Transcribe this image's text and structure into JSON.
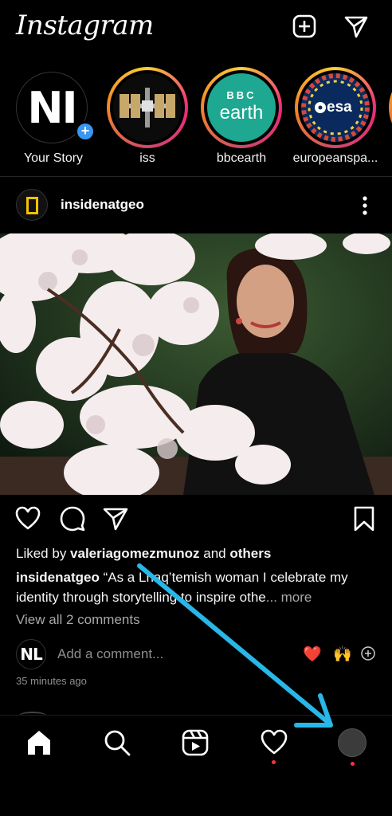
{
  "header": {
    "logo_text": "Instagram",
    "new_post_icon": "plus-square-icon",
    "direct_icon": "paper-plane-icon"
  },
  "stories": [
    {
      "name": "Your Story",
      "avatar_text": "NI"
    },
    {
      "name": "iss"
    },
    {
      "name": "bbcearth",
      "logo_line1": "BBC",
      "logo_line2": "earth"
    },
    {
      "name": "europeanspa...",
      "logo_text": "esa"
    }
  ],
  "post": {
    "username": "insidenatgeo",
    "liked_by_prefix": "Liked by ",
    "liked_by_user": "valeriagomezmunoz",
    "liked_by_mid": " and ",
    "liked_by_others": "others",
    "caption_user": "insidenatgeo",
    "caption_text": " “As a Lhaq’temish woman I celebrate my identity through storytelling to inspire othe",
    "caption_more": "... more",
    "view_comments": "View all 2 comments",
    "add_comment_placeholder": "Add a comment...",
    "my_avatar_text": "NL",
    "quick_emojis": [
      "❤️",
      "🙌"
    ],
    "time_ago": "35 minutes ago"
  },
  "nav": {
    "items": [
      "home-icon",
      "search-icon",
      "reels-icon",
      "activity-heart-icon",
      "profile-avatar"
    ],
    "notification_color": "#ff3040"
  },
  "colors": {
    "accent_blue": "#3897f0",
    "annotation_arrow": "#29b6e8",
    "bbc_earth_green": "#1fa891",
    "esa_navy": "#0a2a5e"
  }
}
